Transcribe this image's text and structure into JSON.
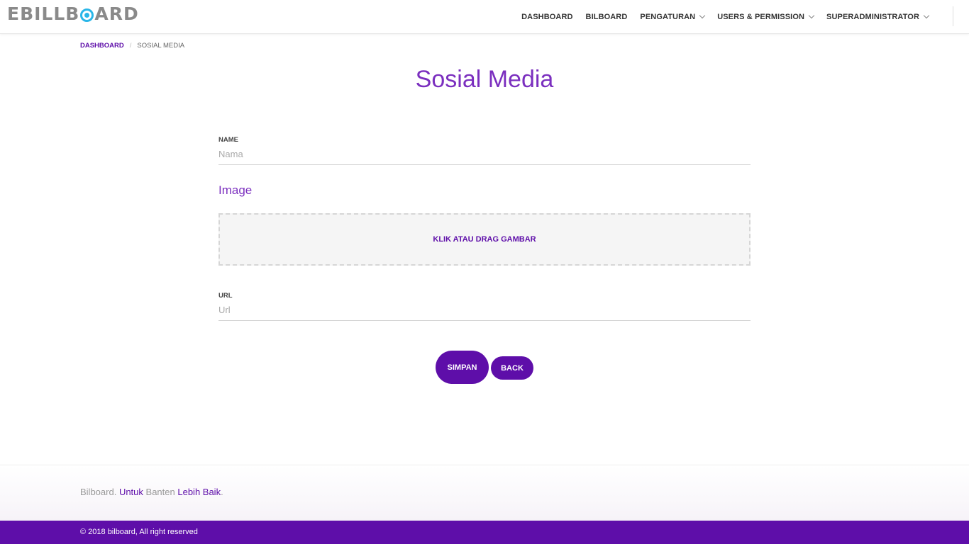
{
  "logo": {
    "prefix": "EBILLB",
    "suffix": "ARD"
  },
  "nav": {
    "items": [
      {
        "label": "DASHBOARD"
      },
      {
        "label": "BILBOARD"
      },
      {
        "label": "PENGATURAN"
      },
      {
        "label": "USERS & PERMISSION"
      },
      {
        "label": "SUPERADMINISTRATOR"
      }
    ]
  },
  "breadcrumb": {
    "home": "DASHBOARD",
    "separator": "/",
    "current": "SOSIAL MEDIA"
  },
  "page": {
    "title": "Sosial Media"
  },
  "form": {
    "name_label": "NAME",
    "name_placeholder": "Nama",
    "image_label": "Image",
    "dropzone_text": "KLIK ATAU DRAG GAMBAR",
    "url_label": "URL",
    "url_placeholder": "Url",
    "save_label": "SIMPAN",
    "back_label": "BACK"
  },
  "footer": {
    "tagline_1": "Bilboard.",
    "tagline_2": "Untuk",
    "tagline_3": "Banten",
    "tagline_4": "Lebih Baik",
    "tagline_5": ".",
    "copyright": "© 2018 bilboard, All right reserved"
  },
  "colors": {
    "accent": "#5e0ea9",
    "title": "#7b2fbf",
    "logo_mark": "#29b6e8"
  }
}
